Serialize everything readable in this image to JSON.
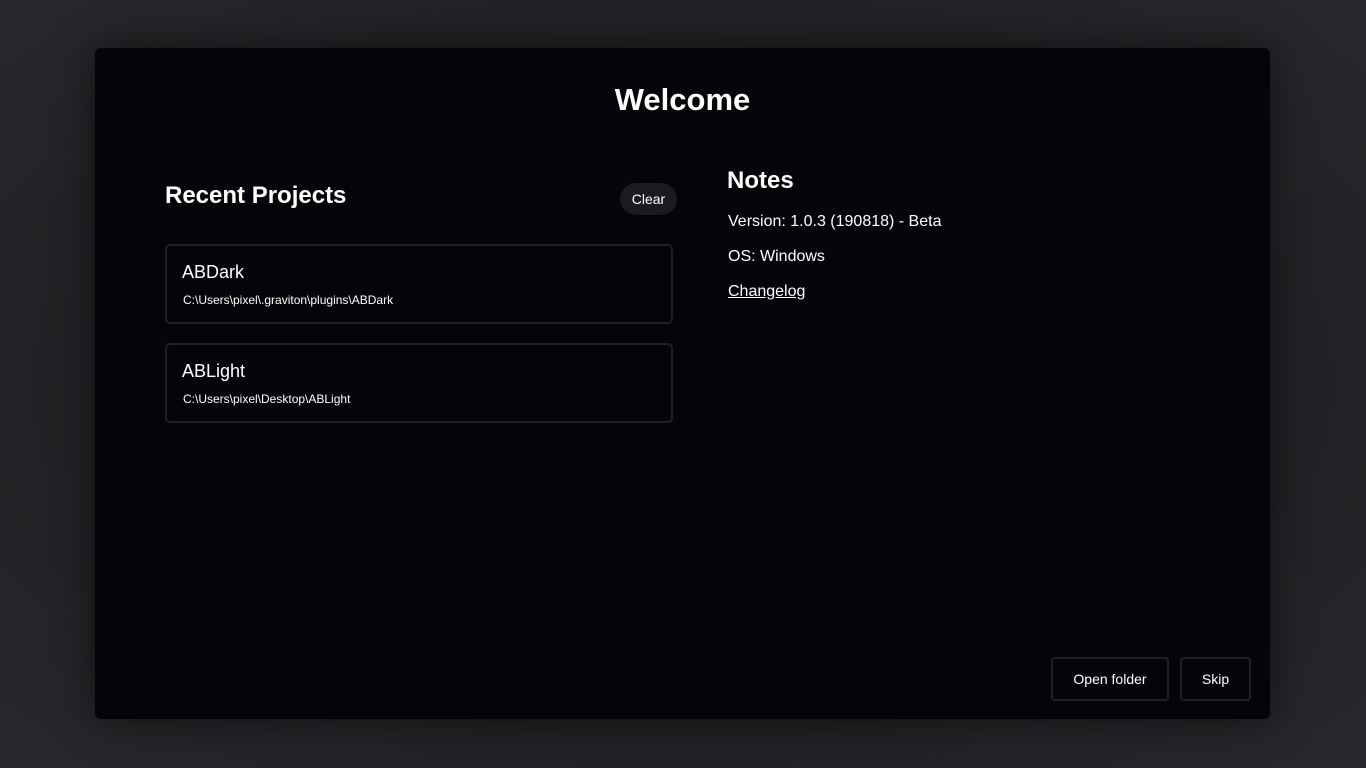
{
  "welcome": {
    "title": "Welcome"
  },
  "recent": {
    "title": "Recent Projects",
    "clear_label": "Clear",
    "projects": [
      {
        "name": "ABDark",
        "path": "C:\\Users\\pixel\\.graviton\\plugins\\ABDark"
      },
      {
        "name": "ABLight",
        "path": "C:\\Users\\pixel\\Desktop\\ABLight"
      }
    ]
  },
  "notes": {
    "title": "Notes",
    "version": "Version: 1.0.3 (190818) - Beta",
    "os": "OS: Windows",
    "changelog_label": "Changelog"
  },
  "footer": {
    "open_folder_label": "Open folder",
    "skip_label": "Skip"
  },
  "colors": {
    "dialog_background": "#050509",
    "page_background": "#1e1f22",
    "card_border": "#1f2024",
    "clear_button_background": "#1b1c20",
    "text": "#ffffff"
  }
}
